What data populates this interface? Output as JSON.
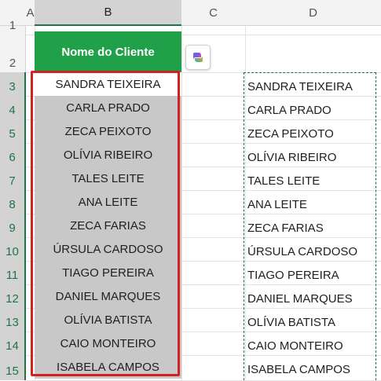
{
  "columns": {
    "a": "A",
    "b": "B",
    "c": "C",
    "d": "D"
  },
  "rows": [
    "1",
    "2",
    "3",
    "4",
    "5",
    "6",
    "7",
    "8",
    "9",
    "10",
    "11",
    "12",
    "13",
    "14",
    "15"
  ],
  "header_label": "Nome do Cliente",
  "names_b": [
    "SANDRA TEIXEIRA",
    "CARLA PRADO",
    "ZECA PEIXOTO",
    "OLÍVIA RIBEIRO",
    "TALES LEITE",
    "ANA LEITE",
    "ZECA FARIAS",
    "ÚRSULA CARDOSO",
    "TIAGO PEREIRA",
    "DANIEL MARQUES",
    "OLÍVIA BATISTA",
    "CAIO MONTEIRO",
    "ISABELA CAMPOS"
  ],
  "names_d": [
    "SANDRA TEIXEIRA",
    "CARLA PRADO",
    "ZECA PEIXOTO",
    "OLÍVIA RIBEIRO",
    "TALES LEITE",
    "ANA LEITE",
    "ZECA FARIAS",
    "ÚRSULA CARDOSO",
    "TIAGO PEREIRA",
    "DANIEL MARQUES",
    "OLÍVIA BATISTA",
    "CAIO MONTEIRO",
    "ISABELA CAMPOS"
  ],
  "colors": {
    "header_green": "#21a04a",
    "selection_red": "#d42020",
    "excel_green": "#217346"
  },
  "icons": {
    "copilot": "copilot-icon"
  }
}
